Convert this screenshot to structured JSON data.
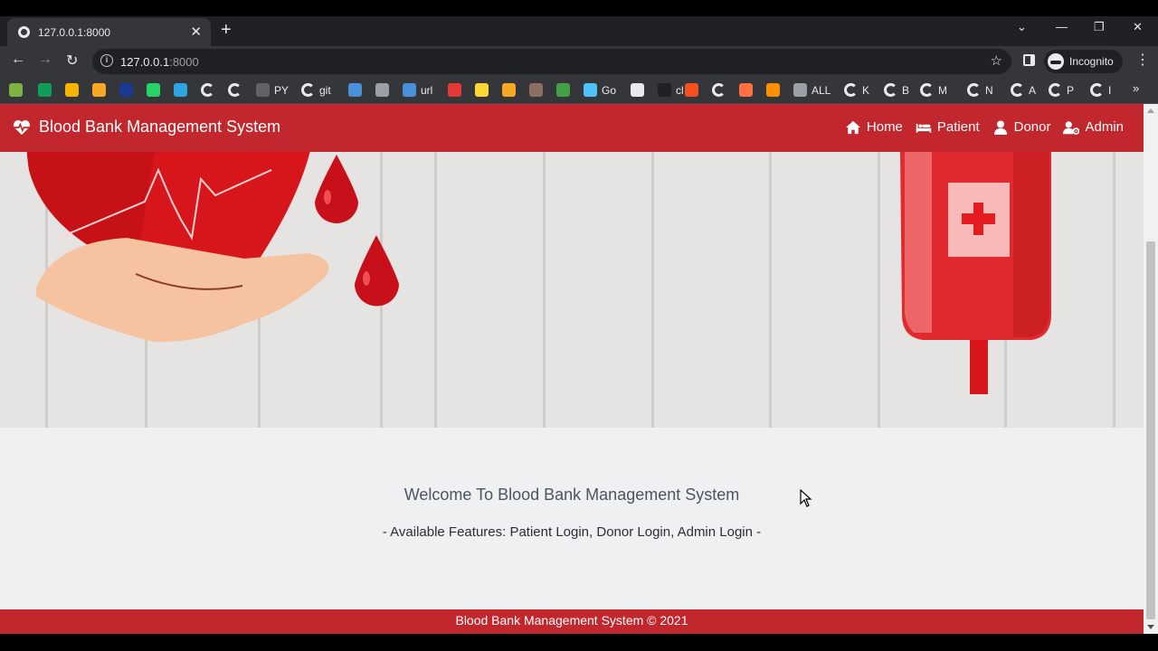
{
  "browser": {
    "tab_title": "127.0.0.1:8000",
    "url_host": "127.0.0.1",
    "url_port": ":8000",
    "profile_label": "Incognito",
    "bookmarks": [
      {
        "label": "",
        "color": "#7cb342",
        "kind": "box"
      },
      {
        "label": "",
        "color": "#0f9d58",
        "kind": "box"
      },
      {
        "label": "",
        "color": "#f4b400",
        "kind": "box"
      },
      {
        "label": "",
        "color": "#f9a825",
        "kind": "box"
      },
      {
        "label": "",
        "color": "#1a3a8f",
        "kind": "box"
      },
      {
        "label": "",
        "color": "#25d366",
        "kind": "box"
      },
      {
        "label": "",
        "color": "#2ca5e0",
        "kind": "box"
      },
      {
        "label": "",
        "kind": "g"
      },
      {
        "label": "",
        "kind": "g"
      },
      {
        "label": "PY",
        "color": "#5f6368",
        "kind": "box"
      },
      {
        "label": "git",
        "kind": "g"
      },
      {
        "label": "",
        "color": "#4a90d9",
        "kind": "box"
      },
      {
        "label": "",
        "color": "#9aa0a6",
        "kind": "box"
      },
      {
        "label": "url",
        "color": "#4a90d9",
        "kind": "box"
      },
      {
        "label": "",
        "color": "#e53935",
        "kind": "box"
      },
      {
        "label": "",
        "color": "#fdd835",
        "kind": "box"
      },
      {
        "label": "",
        "color": "#f9a825",
        "kind": "box"
      },
      {
        "label": "",
        "color": "#8d6e63",
        "kind": "box"
      },
      {
        "label": "",
        "color": "#43a047",
        "kind": "box"
      },
      {
        "label": "Go",
        "color": "#4fc3f7",
        "kind": "box"
      },
      {
        "label": "",
        "color": "#e8eaed",
        "kind": "box"
      },
      {
        "label": "cl",
        "color": "#202124",
        "kind": "box"
      },
      {
        "label": "",
        "color": "#f4511e",
        "kind": "box"
      },
      {
        "label": "",
        "kind": "g"
      },
      {
        "label": "",
        "color": "#ff7043",
        "kind": "box"
      },
      {
        "label": "",
        "color": "#ff8f00",
        "kind": "box"
      },
      {
        "label": "ALL",
        "color": "#9aa0a6",
        "kind": "box"
      },
      {
        "label": "K",
        "kind": "g"
      },
      {
        "label": "B",
        "kind": "g"
      },
      {
        "label": "M",
        "kind": "g"
      },
      {
        "label": "N",
        "kind": "g"
      },
      {
        "label": "A",
        "kind": "g"
      },
      {
        "label": "P",
        "kind": "g"
      },
      {
        "label": "I",
        "kind": "g"
      }
    ]
  },
  "site": {
    "brand": "Blood Bank Management System",
    "nav": [
      {
        "label": "Home",
        "icon": "home-icon"
      },
      {
        "label": "Patient",
        "icon": "bed-icon"
      },
      {
        "label": "Donor",
        "icon": "user-icon"
      },
      {
        "label": "Admin",
        "icon": "user-cog-icon"
      }
    ],
    "welcome": "Welcome To Blood Bank Management System",
    "features": "- Available Features: Patient Login, Donor Login, Admin Login -",
    "footer": "Blood Bank Management System © 2021",
    "colors": {
      "primary": "#c1272d",
      "blood": "#d7161c"
    }
  }
}
